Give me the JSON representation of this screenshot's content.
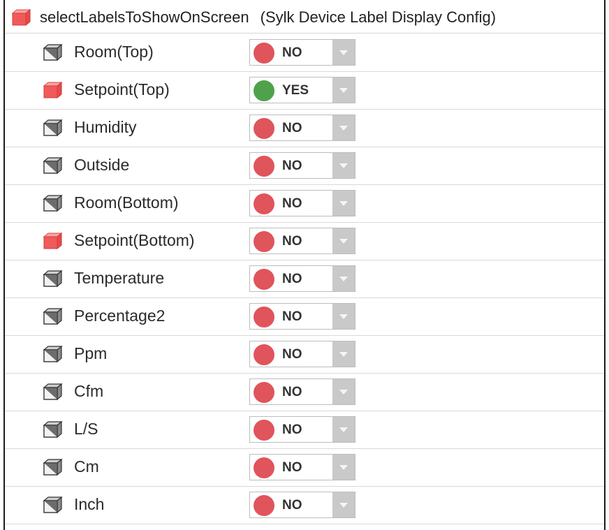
{
  "header": {
    "name": "selectLabelsToShowOnScreen",
    "type": "(Sylk Device Label Display Config)",
    "icon": "red-property-cube-icon"
  },
  "colors": {
    "no": "#e0545c",
    "yes": "#4fa24b",
    "red_cube": "#f05a5a",
    "gray_cube": "#666666"
  },
  "rows": [
    {
      "label": "Room(Top)",
      "value": "NO",
      "icon": "gray-property-cube-icon"
    },
    {
      "label": "Setpoint(Top)",
      "value": "YES",
      "icon": "red-property-cube-icon"
    },
    {
      "label": "Humidity",
      "value": "NO",
      "icon": "gray-property-cube-icon"
    },
    {
      "label": "Outside",
      "value": "NO",
      "icon": "gray-property-cube-icon"
    },
    {
      "label": "Room(Bottom)",
      "value": "NO",
      "icon": "gray-property-cube-icon"
    },
    {
      "label": "Setpoint(Bottom)",
      "value": "NO",
      "icon": "red-property-cube-icon"
    },
    {
      "label": "Temperature",
      "value": "NO",
      "icon": "gray-property-cube-icon"
    },
    {
      "label": "Percentage2",
      "value": "NO",
      "icon": "gray-property-cube-icon"
    },
    {
      "label": "Ppm",
      "value": "NO",
      "icon": "gray-property-cube-icon"
    },
    {
      "label": "Cfm",
      "value": "NO",
      "icon": "gray-property-cube-icon"
    },
    {
      "label": "L/S",
      "value": "NO",
      "icon": "gray-property-cube-icon"
    },
    {
      "label": "Cm",
      "value": "NO",
      "icon": "gray-property-cube-icon"
    },
    {
      "label": "Inch",
      "value": "NO",
      "icon": "gray-property-cube-icon"
    }
  ]
}
